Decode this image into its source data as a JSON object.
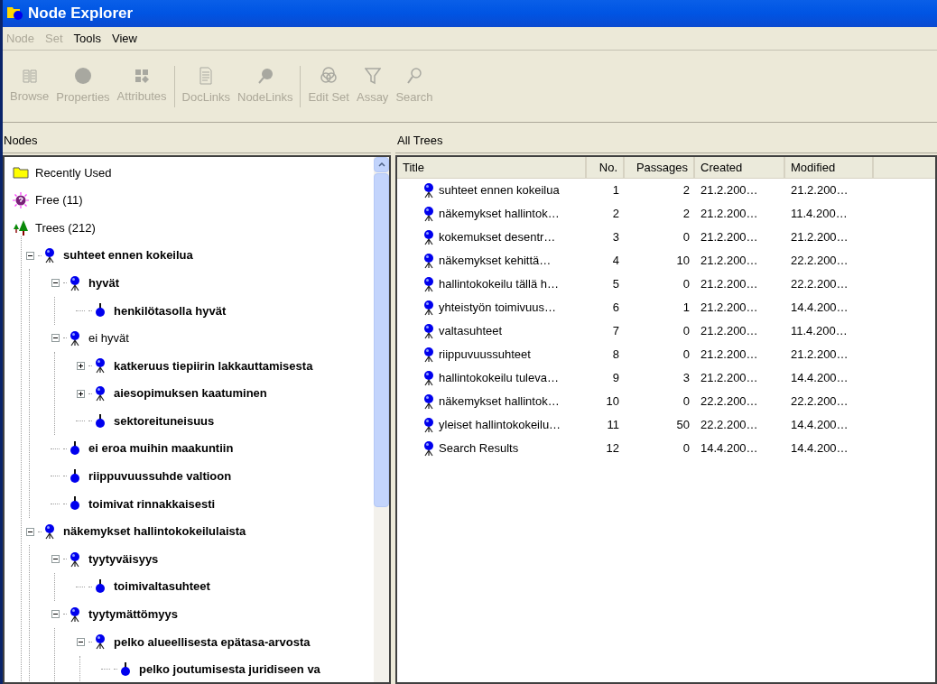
{
  "window": {
    "title": "Node Explorer"
  },
  "menu": [
    {
      "label": "Node",
      "disabled": true
    },
    {
      "label": "Set",
      "disabled": true
    },
    {
      "label": "Tools",
      "disabled": false
    },
    {
      "label": "View",
      "disabled": false
    }
  ],
  "toolbar": [
    [
      {
        "label": "Browse",
        "disabled": true
      },
      {
        "label": "Properties",
        "disabled": true
      },
      {
        "label": "Attributes",
        "disabled": true
      }
    ],
    [
      {
        "label": "DocLinks",
        "disabled": true
      },
      {
        "label": "NodeLinks",
        "disabled": true
      }
    ],
    [
      {
        "label": "Edit Set",
        "disabled": true
      },
      {
        "label": "Assay",
        "disabled": true
      },
      {
        "label": "Search",
        "disabled": true
      }
    ]
  ],
  "nodes_pane": {
    "title": "Nodes",
    "items": [
      {
        "kind": "folder",
        "label": "Recently Used"
      },
      {
        "kind": "free",
        "label": "Free (11)"
      },
      {
        "kind": "trees",
        "label": "Trees (212)",
        "children": [
          {
            "label": "suhteet ennen kokeilua",
            "bold": true,
            "expanded": true,
            "children": [
              {
                "label": "hyvät",
                "bold": true,
                "expanded": true,
                "children": [
                  {
                    "label": "henkilötasolla hyvät",
                    "bold": true
                  }
                ]
              },
              {
                "label": "ei hyvät",
                "bold": false,
                "expanded": true,
                "children": [
                  {
                    "label": "katkeruus tiepiirin lakkauttamisesta",
                    "bold": true,
                    "expanded": false
                  },
                  {
                    "label": "aiesopimuksen kaatuminen",
                    "bold": true,
                    "expanded": false
                  },
                  {
                    "label": "sektoreituneisuus",
                    "bold": true
                  }
                ]
              },
              {
                "label": "ei eroa muihin maakuntiin",
                "bold": true
              },
              {
                "label": "riippuvuussuhde valtioon",
                "bold": true
              },
              {
                "label": "toimivat rinnakkaisesti",
                "bold": true
              }
            ]
          },
          {
            "label": "näkemykset hallintokokeilulaista",
            "bold": true,
            "expanded": true,
            "children": [
              {
                "label": "tyytyväisyys",
                "bold": true,
                "expanded": true,
                "children": [
                  {
                    "label": "toimivaltasuhteet",
                    "bold": true
                  }
                ]
              },
              {
                "label": "tyytymättömyys",
                "bold": true,
                "expanded": true,
                "children": [
                  {
                    "label": "pelko alueellisesta epätasa-arvosta",
                    "bold": true,
                    "expanded": true,
                    "children": [
                      {
                        "label": "pelko joutumisesta juridiseen va",
                        "bold": true
                      }
                    ]
                  }
                ]
              }
            ]
          }
        ]
      }
    ]
  },
  "trees_pane": {
    "title": "All Trees",
    "columns": [
      "Title",
      "No.",
      "Passages",
      "Created",
      "Modified"
    ],
    "rows": [
      {
        "title": "suhteet ennen kokeilua",
        "no": "1",
        "passages": "2",
        "created": "21.2.200…",
        "modified": "21.2.200…"
      },
      {
        "title": "näkemykset hallintok…",
        "no": "2",
        "passages": "2",
        "created": "21.2.200…",
        "modified": "11.4.200…"
      },
      {
        "title": "kokemukset desentr…",
        "no": "3",
        "passages": "0",
        "created": "21.2.200…",
        "modified": "21.2.200…"
      },
      {
        "title": "näkemykset kehittä…",
        "no": "4",
        "passages": "10",
        "created": "21.2.200…",
        "modified": "22.2.200…"
      },
      {
        "title": "hallintokokeilu tällä h…",
        "no": "5",
        "passages": "0",
        "created": "21.2.200…",
        "modified": "22.2.200…"
      },
      {
        "title": "yhteistyön toimivuus…",
        "no": "6",
        "passages": "1",
        "created": "21.2.200…",
        "modified": "14.4.200…"
      },
      {
        "title": "valtasuhteet",
        "no": "7",
        "passages": "0",
        "created": "21.2.200…",
        "modified": "11.4.200…"
      },
      {
        "title": "riippuvuussuhteet",
        "no": "8",
        "passages": "0",
        "created": "21.2.200…",
        "modified": "21.2.200…"
      },
      {
        "title": "hallintokokeilu tuleva…",
        "no": "9",
        "passages": "3",
        "created": "21.2.200…",
        "modified": "14.4.200…"
      },
      {
        "title": "näkemykset hallintok…",
        "no": "10",
        "passages": "0",
        "created": "22.2.200…",
        "modified": "22.2.200…"
      },
      {
        "title": "yleiset hallintokokeilu…",
        "no": "11",
        "passages": "50",
        "created": "22.2.200…",
        "modified": "14.4.200…"
      },
      {
        "title": "Search Results",
        "no": "12",
        "passages": "0",
        "created": "14.4.200…",
        "modified": "14.4.200…"
      }
    ]
  }
}
